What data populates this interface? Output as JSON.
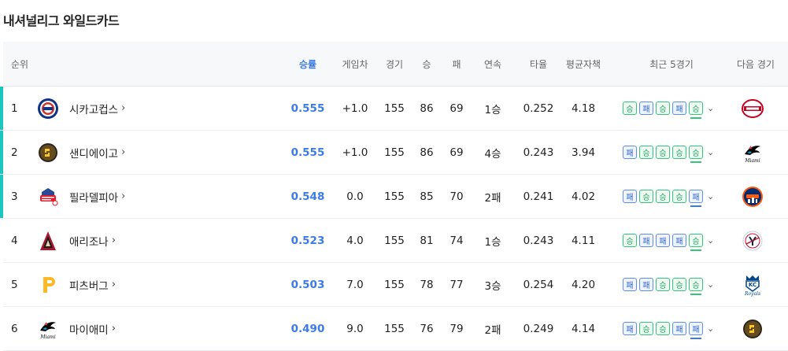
{
  "title": "내셔널리그 와일드카드",
  "columns": {
    "rank": "순위",
    "pct": "승률",
    "gb": "게임차",
    "games": "경기",
    "wins": "승",
    "losses": "패",
    "streak": "연속",
    "avg": "타율",
    "era": "평균자책",
    "last5": "최근 5경기",
    "next": "다음 경기"
  },
  "colors": {
    "accent": "#3b7be8",
    "wildcard_bar": "#19c6c0",
    "win": "#32c87a",
    "loss": "#5b8fe8"
  },
  "rows": [
    {
      "rank": "1",
      "team": "시카고컵스",
      "logo": "cubs-logo-icon",
      "pct": "0.555",
      "gb": "+1.0",
      "games": "155",
      "wins": "86",
      "losses": "69",
      "streak": "1승",
      "avg": "0.252",
      "era": "4.18",
      "wildcard": true,
      "last5": [
        "승",
        "패",
        "승",
        "패",
        "승"
      ],
      "next_logo": "reds-logo-icon"
    },
    {
      "rank": "2",
      "team": "샌디에이고",
      "logo": "padres-logo-icon",
      "pct": "0.555",
      "gb": "+1.0",
      "games": "155",
      "wins": "86",
      "losses": "69",
      "streak": "4승",
      "avg": "0.243",
      "era": "3.94",
      "wildcard": true,
      "last5": [
        "패",
        "승",
        "승",
        "승",
        "승"
      ],
      "next_logo": "marlins-logo-icon"
    },
    {
      "rank": "3",
      "team": "필라델피아",
      "logo": "phillies-logo-icon",
      "pct": "0.548",
      "gb": "0.0",
      "games": "155",
      "wins": "85",
      "losses": "70",
      "streak": "2패",
      "avg": "0.241",
      "era": "4.02",
      "wildcard": true,
      "last5": [
        "패",
        "승",
        "승",
        "승",
        "패"
      ],
      "next_logo": "mets-logo-icon"
    },
    {
      "rank": "4",
      "team": "애리조나",
      "logo": "diamondbacks-logo-icon",
      "pct": "0.523",
      "gb": "4.0",
      "games": "155",
      "wins": "81",
      "losses": "74",
      "streak": "1승",
      "avg": "0.243",
      "era": "4.11",
      "wildcard": false,
      "last5": [
        "승",
        "패",
        "패",
        "패",
        "승"
      ],
      "next_logo": "yankees-logo-icon"
    },
    {
      "rank": "5",
      "team": "피츠버그",
      "logo": "pirates-logo-icon",
      "pct": "0.503",
      "gb": "7.0",
      "games": "155",
      "wins": "78",
      "losses": "77",
      "streak": "3승",
      "avg": "0.254",
      "era": "4.20",
      "wildcard": false,
      "last5": [
        "패",
        "패",
        "승",
        "승",
        "승"
      ],
      "next_logo": "royals-logo-icon"
    },
    {
      "rank": "6",
      "team": "마이애미",
      "logo": "marlins-logo-icon",
      "pct": "0.490",
      "gb": "9.0",
      "games": "155",
      "wins": "76",
      "losses": "79",
      "streak": "2패",
      "avg": "0.249",
      "era": "4.14",
      "wildcard": false,
      "last5": [
        "패",
        "승",
        "승",
        "패",
        "패"
      ],
      "next_logo": "padres-logo-icon"
    }
  ]
}
